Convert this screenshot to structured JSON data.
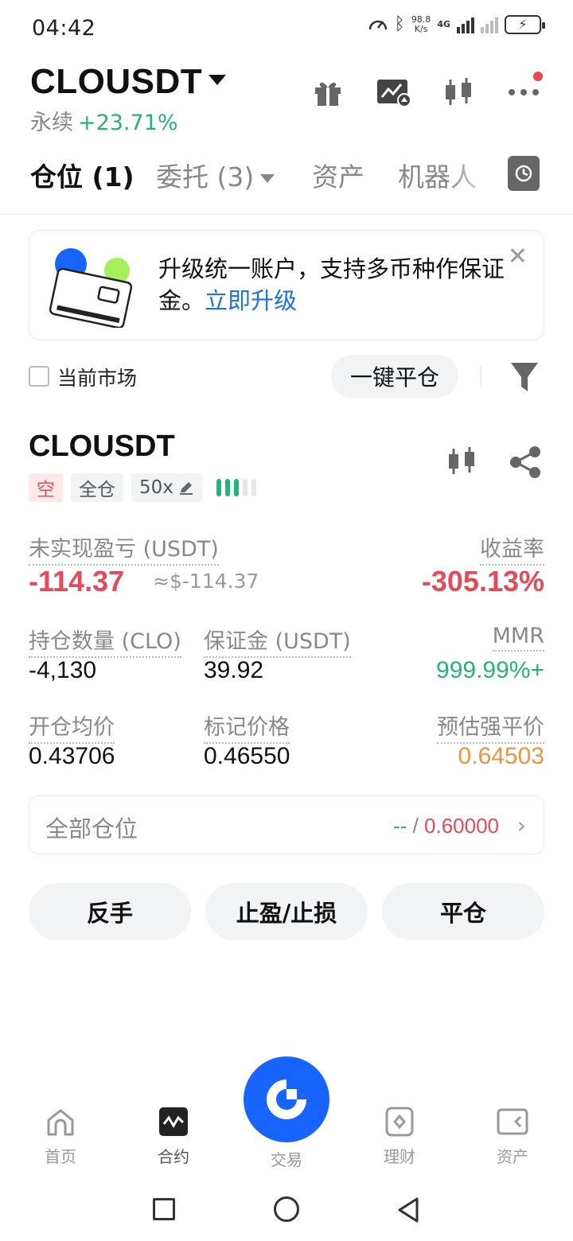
{
  "status_bar": {
    "time": "04:42",
    "net_speed_value": "98.8",
    "net_speed_unit": "K/s",
    "network": "4G"
  },
  "header": {
    "symbol": "CLOUSDT",
    "contract_type": "永续",
    "change_pct": "+23.71%",
    "icons": [
      "gift-icon",
      "chart-settings-icon",
      "candlestick-icon",
      "more-icon"
    ]
  },
  "tabs": [
    {
      "label": "仓位 (1)",
      "active": true
    },
    {
      "label": "委托 (3)",
      "active": false
    },
    {
      "label": "资产",
      "active": false
    },
    {
      "label": "机器人",
      "active": false
    }
  ],
  "banner": {
    "text": "升级统一账户，支持多币种作保证金。",
    "link": "立即升级"
  },
  "filter": {
    "current_market_label": "当前市场",
    "close_all_label": "一键平仓"
  },
  "position": {
    "symbol": "CLOUSDT",
    "side_tag": "空",
    "margin_mode_tag": "全仓",
    "leverage_tag": "50x",
    "risk_level": 3,
    "unrealized_pnl_label": "未实现盈亏 (USDT)",
    "unrealized_pnl": "-114.37",
    "unrealized_pnl_usd": "≈$-114.37",
    "roi_label": "收益率",
    "roi": "-305.13%",
    "size_label": "持仓数量 (CLO)",
    "size": "-4,130",
    "margin_label": "保证金 (USDT)",
    "margin": "39.92",
    "mmr_label": "MMR",
    "mmr": "999.99%+",
    "entry_label": "开仓均价",
    "entry_price": "0.43706",
    "mark_label": "标记价格",
    "mark_price": "0.46550",
    "liq_label": "预估强平价",
    "liq_price": "0.64503",
    "all_positions_label": "全部仓位",
    "all_positions_left": "--",
    "all_positions_sep": " / ",
    "all_positions_right": "0.60000"
  },
  "actions": {
    "reverse": "反手",
    "tp_sl": "止盈/止损",
    "close": "平仓"
  },
  "bottom_nav": {
    "home": "首页",
    "futures": "合约",
    "trade": "交易",
    "earn": "理财",
    "assets": "资产"
  },
  "colors": {
    "up_green": "#25b37a",
    "down_red": "#e24b5a",
    "liq_orange": "#f0913f",
    "brand_blue": "#1764ff",
    "link_blue": "#1a73e8"
  }
}
